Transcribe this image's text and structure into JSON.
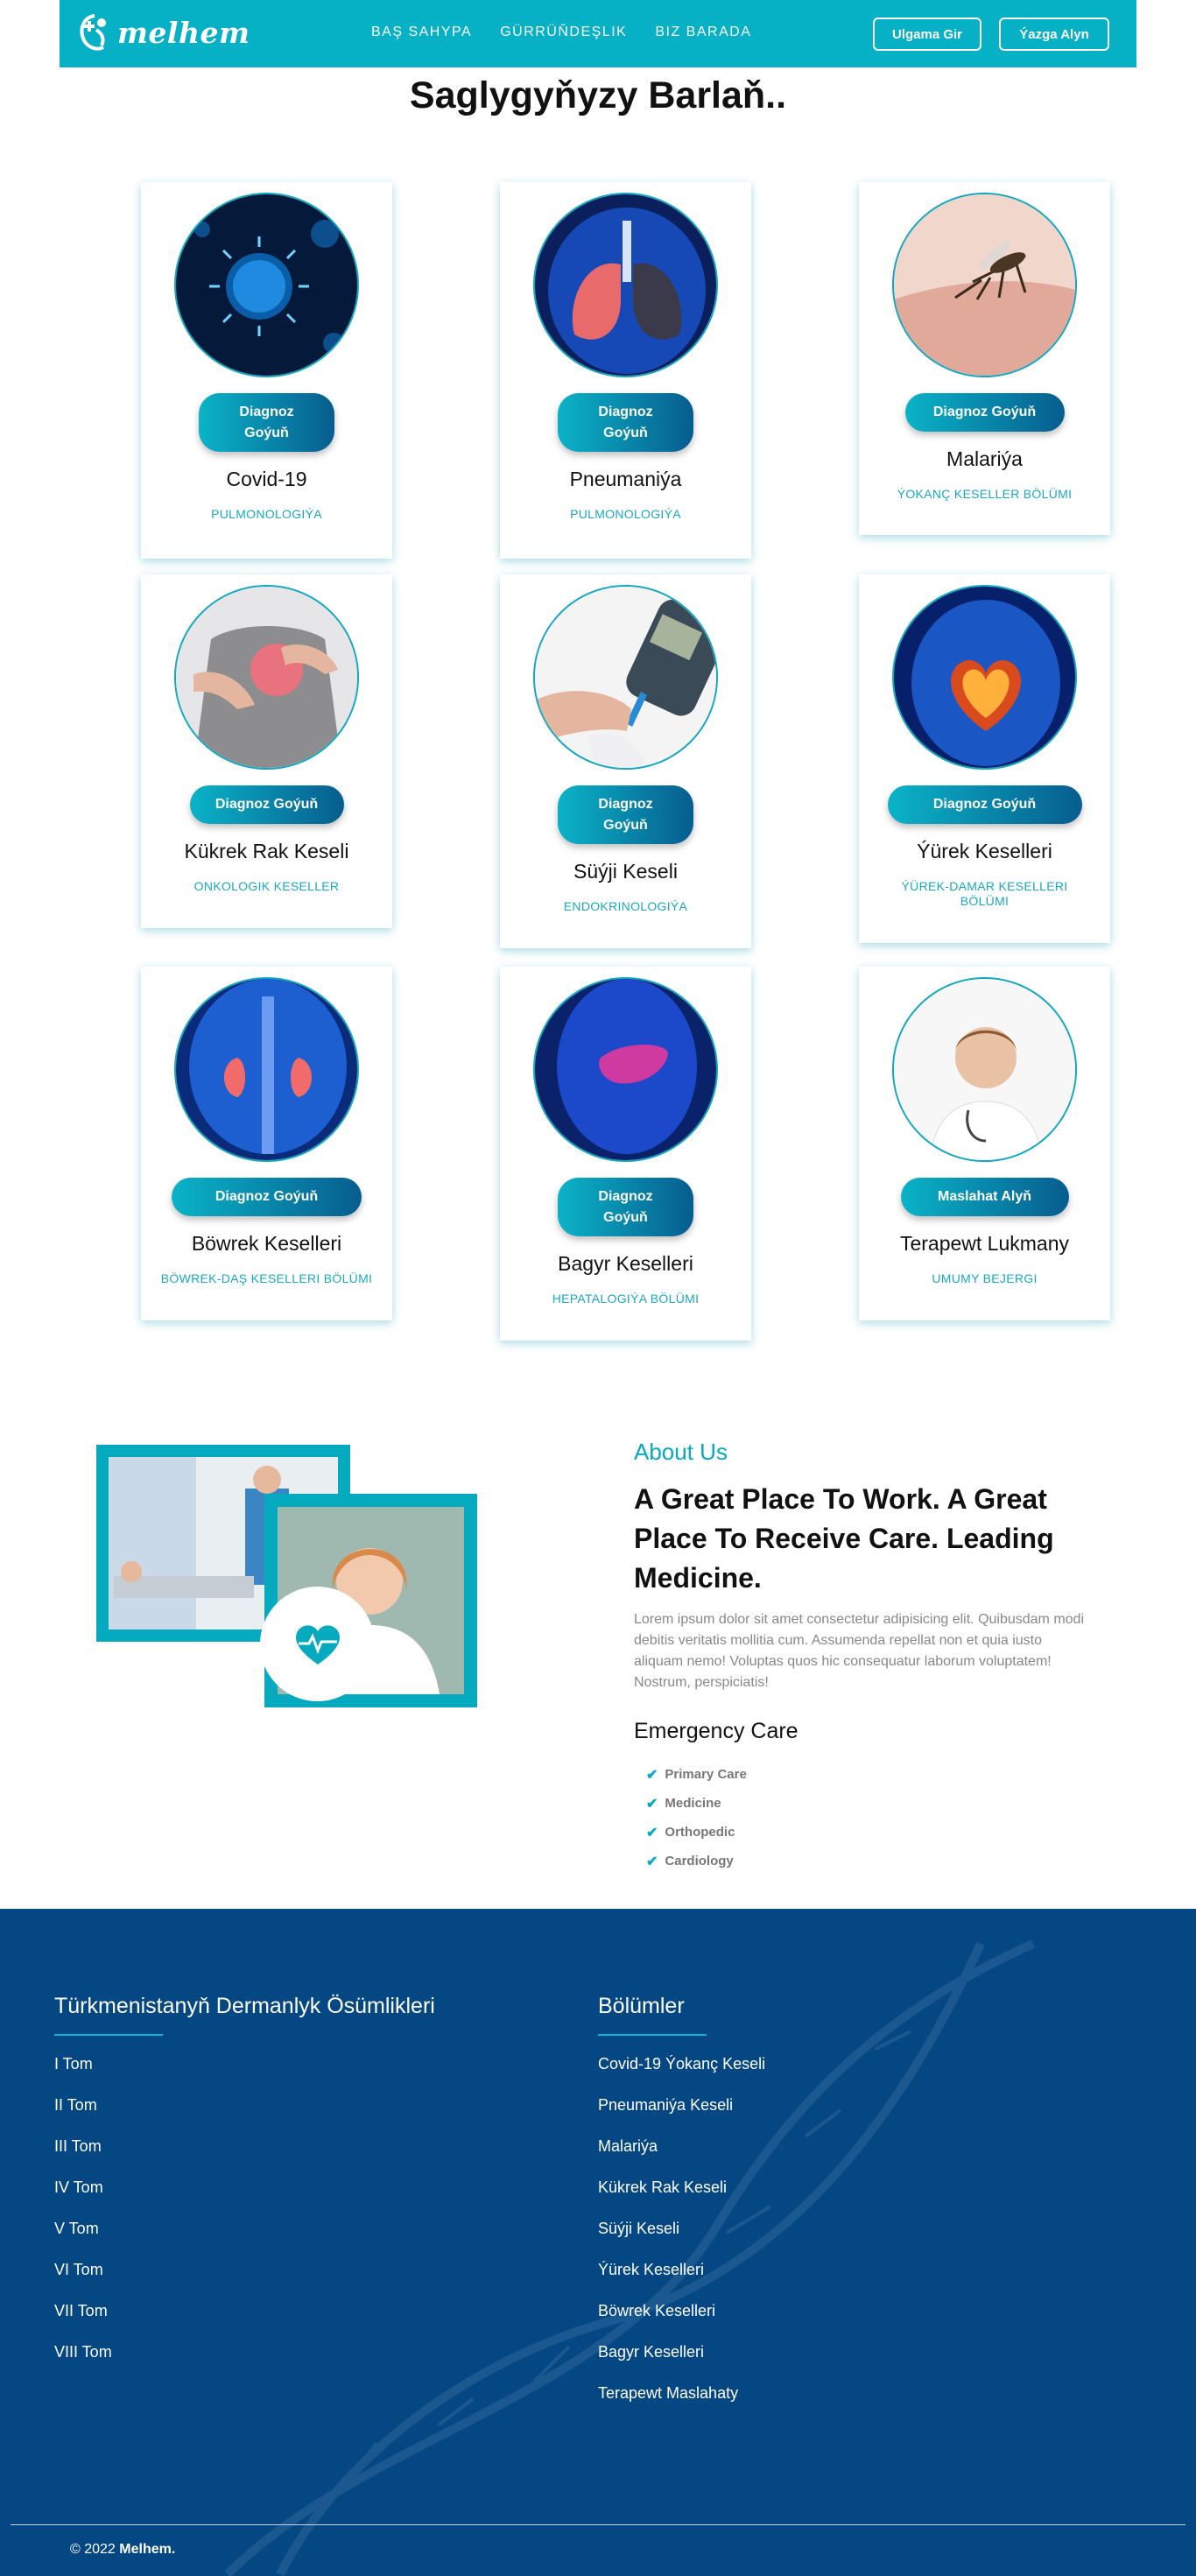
{
  "brand": {
    "logo_text": "melhem"
  },
  "nav": {
    "items": [
      "BAŞ SAHYPA",
      "GÜRRÜŇDEŞLIK",
      "BIZ BARADA"
    ],
    "login": "Ulgama Gir",
    "register": "Ýazga Alyn"
  },
  "page_title": "Saglygyňyzy Barlaň..",
  "cards": [
    {
      "name": "Covid-19",
      "dept": "PULMONOLOGIÝA",
      "button": "Diagnoz Goýuň",
      "image": "virus-image"
    },
    {
      "name": "Pneumaniýa",
      "dept": "PULMONOLOGIÝA",
      "button": "Diagnoz Goýuň",
      "image": "lungs-image"
    },
    {
      "name": "Malariýa",
      "dept": "ÝOKANÇ KESELLER BÖLÜMI",
      "button": "Diagnoz Goýuň",
      "image": "mosquito-image"
    },
    {
      "name": "Kükrek Rak Keseli",
      "dept": "ONKOLOGIK KESELLER",
      "button": "Diagnoz Goýuň",
      "image": "breast-image"
    },
    {
      "name": "Süýji Keseli",
      "dept": "ENDOKRINOLOGIÝA",
      "button": "Diagnoz Goýuň",
      "image": "glucometer-image"
    },
    {
      "name": "Ýürek Keselleri",
      "dept": "ÝÜREK-DAMAR KESELLERI BÖLÜMI",
      "button": "Diagnoz Goýuň",
      "image": "heart-image"
    },
    {
      "name": "Böwrek Keselleri",
      "dept": "BÖWREK-DAŞ KESELLERI BÖLÜMI",
      "button": "Diagnoz Goýuň",
      "image": "kidneys-image"
    },
    {
      "name": "Bagyr Keselleri",
      "dept": "HEPATALOGIÝA BÖLÜMI",
      "button": "Diagnoz Goýuň",
      "image": "liver-image"
    },
    {
      "name": "Terapewt Lukmany",
      "dept": "UMUMY BEJERGI",
      "button": "Maslahat Alyň",
      "image": "doctor-image"
    }
  ],
  "about": {
    "label": "About Us",
    "title": "A Great Place To Work. A Great Place To Receive Care. Leading Medicine.",
    "text": "Lorem ipsum dolor sit amet consectetur adipisicing elit. Quibusdam modi debitis veritatis mollitia cum. Assumenda repellat non et quia iusto aliquam nemo! Voluptas quos hic consequatur laborum voluptatem! Nostrum, perspiciatis!",
    "emergency_title": "Emergency Care",
    "emergency_items": [
      "Primary Care",
      "Medicine",
      "Orthopedic",
      "Cardiology"
    ]
  },
  "footer": {
    "col1_title": "Türkmenistanyň Dermanlyk Ösümlikleri",
    "col1_items": [
      "I Tom",
      "II Tom",
      "III Tom",
      "IV Tom",
      "V Tom",
      "VI Tom",
      "VII Tom",
      "VIII Tom"
    ],
    "col2_title": "Bölümler",
    "col2_items": [
      "Covid-19 Ýokanç Keseli",
      "Pneumaniýa Keseli",
      "Malariýa",
      "Kükrek Rak Keseli",
      "Süýji Keseli",
      "Ýürek Keselleri",
      "Böwrek Keselleri",
      "Bagyr Keselleri",
      "Terapewt Maslahaty"
    ],
    "copyright_prefix": "© 2022",
    "copyright_brand": "Melhem."
  },
  "colors": {
    "accent": "#06b0c5",
    "footer_bg": "#054782",
    "button_gradient_end": "#075d8e"
  }
}
